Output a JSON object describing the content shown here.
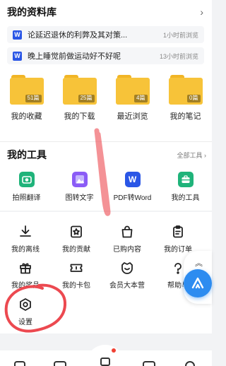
{
  "library": {
    "title": "我的资料库",
    "chevron": "›",
    "recent_docs": [
      {
        "icon": "word-doc-icon",
        "glyph": "W",
        "title": "论延迟退休的利弊及其对策...",
        "time": "1小时前浏览"
      },
      {
        "icon": "word-doc-icon",
        "glyph": "W",
        "title": "晚上睡觉前做运动好不好呢",
        "time": "13小时前浏览"
      }
    ],
    "folders": [
      {
        "label": "我的收藏",
        "count": "51篇"
      },
      {
        "label": "我的下载",
        "count": "25篇"
      },
      {
        "label": "最近浏览",
        "count": "4篇"
      },
      {
        "label": "我的笔记",
        "count": "0篇"
      }
    ]
  },
  "tools": {
    "title": "我的工具",
    "all_link": "全部工具 ›",
    "items": [
      {
        "label": "拍照翻译",
        "icon": "photo-translate-icon",
        "color": "#1fb37a",
        "glyph": ""
      },
      {
        "label": "图转文字",
        "icon": "image-to-text-icon",
        "color": "#8b5cf6",
        "glyph": ""
      },
      {
        "label": "PDF转Word",
        "icon": "pdf-to-word-icon",
        "color": "#2a56e6",
        "glyph": "W"
      },
      {
        "label": "我的工具",
        "icon": "toolbox-icon",
        "color": "#1fb37a",
        "glyph": ""
      }
    ]
  },
  "services": {
    "row1": [
      {
        "label": "我的离线",
        "icon": "offline-download-icon"
      },
      {
        "label": "我的贡献",
        "icon": "contribution-icon"
      },
      {
        "label": "已购内容",
        "icon": "purchased-bag-icon"
      },
      {
        "label": "我的订单",
        "icon": "order-clipboard-icon"
      }
    ],
    "row2": [
      {
        "label": "我的奖品",
        "icon": "gift-icon"
      },
      {
        "label": "我的卡包",
        "icon": "card-wallet-icon"
      },
      {
        "label": "会员大本营",
        "icon": "member-smile-icon"
      },
      {
        "label": "帮助与",
        "icon": "help-icon"
      }
    ],
    "row3": [
      {
        "label": "设置",
        "icon": "settings-hexagon-icon"
      }
    ]
  },
  "floating": {
    "scroll_top": "︽",
    "assistant_icon": "ai-assistant-icon"
  },
  "colors": {
    "accent_blue": "#2d8cf0",
    "folder_yellow": "#f7c339",
    "annotation_red": "#ec4950"
  }
}
